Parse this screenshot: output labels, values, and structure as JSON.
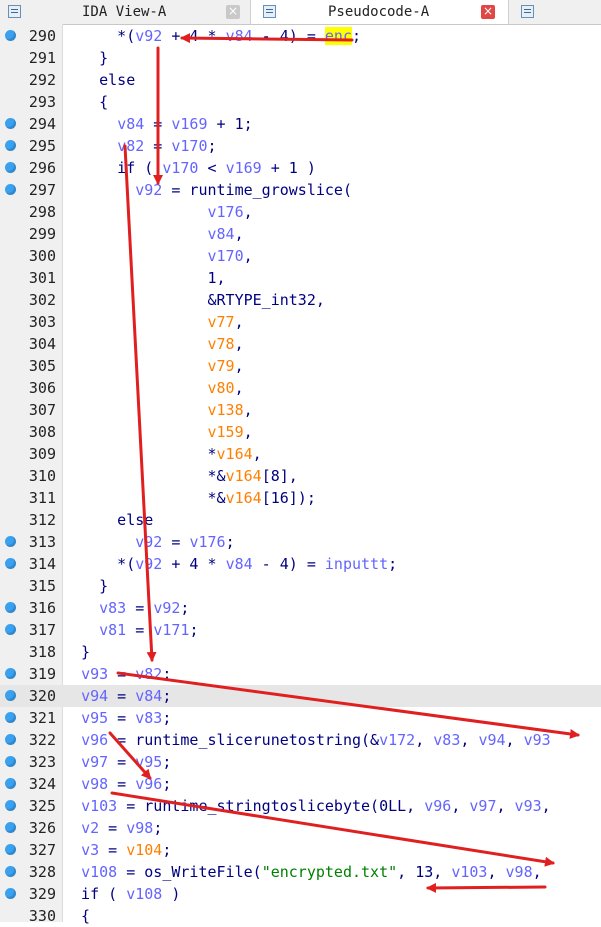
{
  "tabs": [
    {
      "label": "IDA View-A",
      "active": false,
      "close": "grey"
    },
    {
      "label": "Pseudocode-A",
      "active": true,
      "close": "red"
    },
    {
      "label": "",
      "active": false,
      "close": ""
    }
  ],
  "colors": {
    "variable": "#6464ff",
    "symbol": "#ff8000",
    "string": "#008000",
    "keyword": "#000080",
    "breakpoint": "#3aa0f0",
    "highlight": "#ffff00",
    "annotation_arrow": "#e02020"
  },
  "selected_line": 320,
  "code": {
    "lines": [
      {
        "num": "290",
        "bp": true,
        "tokens": [
          [
            "      *(",
            ""
          ],
          [
            "v92",
            "v"
          ],
          [
            " + 4 * ",
            ""
          ],
          [
            "v84",
            "v"
          ],
          [
            " - 4) = ",
            ""
          ],
          [
            "enc",
            "e"
          ],
          [
            ";",
            ""
          ]
        ]
      },
      {
        "num": "291",
        "bp": false,
        "tokens": [
          [
            "    }",
            ""
          ]
        ]
      },
      {
        "num": "292",
        "bp": false,
        "tokens": [
          [
            "    else",
            ""
          ]
        ]
      },
      {
        "num": "293",
        "bp": false,
        "tokens": [
          [
            "    {",
            ""
          ]
        ]
      },
      {
        "num": "294",
        "bp": true,
        "tokens": [
          [
            "      ",
            ""
          ],
          [
            "v84",
            "v"
          ],
          [
            " = ",
            ""
          ],
          [
            "v169",
            "v"
          ],
          [
            " + 1;",
            ""
          ]
        ]
      },
      {
        "num": "295",
        "bp": true,
        "tokens": [
          [
            "      ",
            ""
          ],
          [
            "v82",
            "v"
          ],
          [
            " = ",
            ""
          ],
          [
            "v170",
            "v"
          ],
          [
            ";",
            ""
          ]
        ]
      },
      {
        "num": "296",
        "bp": true,
        "tokens": [
          [
            "      if ( ",
            ""
          ],
          [
            "v170",
            "v"
          ],
          [
            " < ",
            ""
          ],
          [
            "v169",
            "v"
          ],
          [
            " + 1 )",
            ""
          ]
        ]
      },
      {
        "num": "297",
        "bp": true,
        "tokens": [
          [
            "        ",
            ""
          ],
          [
            "v92",
            "v"
          ],
          [
            " = runtime_growslice(",
            ""
          ]
        ]
      },
      {
        "num": "298",
        "bp": false,
        "tokens": [
          [
            "                ",
            ""
          ],
          [
            "v176",
            "v"
          ],
          [
            ",",
            ""
          ]
        ]
      },
      {
        "num": "299",
        "bp": false,
        "tokens": [
          [
            "                ",
            ""
          ],
          [
            "v84",
            "v"
          ],
          [
            ",",
            ""
          ]
        ]
      },
      {
        "num": "300",
        "bp": false,
        "tokens": [
          [
            "                ",
            ""
          ],
          [
            "v170",
            "v"
          ],
          [
            ",",
            ""
          ]
        ]
      },
      {
        "num": "301",
        "bp": false,
        "tokens": [
          [
            "                1,",
            ""
          ]
        ]
      },
      {
        "num": "302",
        "bp": false,
        "tokens": [
          [
            "                &RTYPE_int32,",
            ""
          ]
        ]
      },
      {
        "num": "303",
        "bp": false,
        "tokens": [
          [
            "                ",
            ""
          ],
          [
            "v77",
            "s"
          ],
          [
            ",",
            ""
          ]
        ]
      },
      {
        "num": "304",
        "bp": false,
        "tokens": [
          [
            "                ",
            ""
          ],
          [
            "v78",
            "s"
          ],
          [
            ",",
            ""
          ]
        ]
      },
      {
        "num": "305",
        "bp": false,
        "tokens": [
          [
            "                ",
            ""
          ],
          [
            "v79",
            "s"
          ],
          [
            ",",
            ""
          ]
        ]
      },
      {
        "num": "306",
        "bp": false,
        "tokens": [
          [
            "                ",
            ""
          ],
          [
            "v80",
            "s"
          ],
          [
            ",",
            ""
          ]
        ]
      },
      {
        "num": "307",
        "bp": false,
        "tokens": [
          [
            "                ",
            ""
          ],
          [
            "v138",
            "s"
          ],
          [
            ",",
            ""
          ]
        ]
      },
      {
        "num": "308",
        "bp": false,
        "tokens": [
          [
            "                ",
            ""
          ],
          [
            "v159",
            "s"
          ],
          [
            ",",
            ""
          ]
        ]
      },
      {
        "num": "309",
        "bp": false,
        "tokens": [
          [
            "                *",
            ""
          ],
          [
            "v164",
            "s"
          ],
          [
            ",",
            ""
          ]
        ]
      },
      {
        "num": "310",
        "bp": false,
        "tokens": [
          [
            "                *&",
            ""
          ],
          [
            "v164",
            "s"
          ],
          [
            "[8],",
            ""
          ]
        ]
      },
      {
        "num": "311",
        "bp": false,
        "tokens": [
          [
            "                *&",
            ""
          ],
          [
            "v164",
            "s"
          ],
          [
            "[16]);",
            ""
          ]
        ]
      },
      {
        "num": "312",
        "bp": false,
        "tokens": [
          [
            "      else",
            ""
          ]
        ]
      },
      {
        "num": "313",
        "bp": true,
        "tokens": [
          [
            "        ",
            ""
          ],
          [
            "v92",
            "v"
          ],
          [
            " = ",
            ""
          ],
          [
            "v176",
            "v"
          ],
          [
            ";",
            ""
          ]
        ]
      },
      {
        "num": "314",
        "bp": true,
        "tokens": [
          [
            "      *(",
            ""
          ],
          [
            "v92",
            "v"
          ],
          [
            " + 4 * ",
            ""
          ],
          [
            "v84",
            "v"
          ],
          [
            " - 4) = ",
            ""
          ],
          [
            "inputtt",
            "v"
          ],
          [
            ";",
            ""
          ]
        ]
      },
      {
        "num": "315",
        "bp": false,
        "tokens": [
          [
            "    }",
            ""
          ]
        ]
      },
      {
        "num": "316",
        "bp": true,
        "tokens": [
          [
            "    ",
            ""
          ],
          [
            "v83",
            "v"
          ],
          [
            " = ",
            ""
          ],
          [
            "v92",
            "v"
          ],
          [
            ";",
            ""
          ]
        ]
      },
      {
        "num": "317",
        "bp": true,
        "tokens": [
          [
            "    ",
            ""
          ],
          [
            "v81",
            "v"
          ],
          [
            " = ",
            ""
          ],
          [
            "v171",
            "v"
          ],
          [
            ";",
            ""
          ]
        ]
      },
      {
        "num": "318",
        "bp": false,
        "tokens": [
          [
            "  }",
            ""
          ]
        ]
      },
      {
        "num": "319",
        "bp": true,
        "tokens": [
          [
            "  ",
            ""
          ],
          [
            "v93",
            "v"
          ],
          [
            " = ",
            ""
          ],
          [
            "v82",
            "v"
          ],
          [
            ";",
            ""
          ]
        ]
      },
      {
        "num": "320",
        "bp": true,
        "tokens": [
          [
            "  ",
            ""
          ],
          [
            "v94",
            "v"
          ],
          [
            " = ",
            ""
          ],
          [
            "v84",
            "v"
          ],
          [
            ";",
            ""
          ]
        ]
      },
      {
        "num": "321",
        "bp": true,
        "tokens": [
          [
            "  ",
            ""
          ],
          [
            "v95",
            "v"
          ],
          [
            " = ",
            ""
          ],
          [
            "v83",
            "v"
          ],
          [
            ";",
            ""
          ]
        ]
      },
      {
        "num": "322",
        "bp": true,
        "tokens": [
          [
            "  ",
            ""
          ],
          [
            "v96",
            "v"
          ],
          [
            " = runtime_slicerunetostring(&",
            ""
          ],
          [
            "v172",
            "v"
          ],
          [
            ", ",
            ""
          ],
          [
            "v83",
            "v"
          ],
          [
            ", ",
            ""
          ],
          [
            "v94",
            "v"
          ],
          [
            ", ",
            ""
          ],
          [
            "v93",
            "v"
          ]
        ]
      },
      {
        "num": "323",
        "bp": true,
        "tokens": [
          [
            "  ",
            ""
          ],
          [
            "v97",
            "v"
          ],
          [
            " = ",
            ""
          ],
          [
            "v95",
            "v"
          ],
          [
            ";",
            ""
          ]
        ]
      },
      {
        "num": "324",
        "bp": true,
        "tokens": [
          [
            "  ",
            ""
          ],
          [
            "v98",
            "v"
          ],
          [
            " = ",
            ""
          ],
          [
            "v96",
            "v"
          ],
          [
            ";",
            ""
          ]
        ]
      },
      {
        "num": "325",
        "bp": true,
        "tokens": [
          [
            "  ",
            ""
          ],
          [
            "v103",
            "v"
          ],
          [
            " = runtime_stringtoslicebyte(0LL, ",
            ""
          ],
          [
            "v96",
            "v"
          ],
          [
            ", ",
            ""
          ],
          [
            "v97",
            "v"
          ],
          [
            ", ",
            ""
          ],
          [
            "v93",
            "v"
          ],
          [
            ",",
            ""
          ]
        ]
      },
      {
        "num": "326",
        "bp": true,
        "tokens": [
          [
            "  ",
            ""
          ],
          [
            "v2",
            "v"
          ],
          [
            " = ",
            ""
          ],
          [
            "v98",
            "v"
          ],
          [
            ";",
            ""
          ]
        ]
      },
      {
        "num": "327",
        "bp": true,
        "tokens": [
          [
            "  ",
            ""
          ],
          [
            "v3",
            "v"
          ],
          [
            " = ",
            ""
          ],
          [
            "v104",
            "s"
          ],
          [
            ";",
            ""
          ]
        ]
      },
      {
        "num": "328",
        "bp": true,
        "tokens": [
          [
            "  ",
            ""
          ],
          [
            "v108",
            "v"
          ],
          [
            " = os_WriteFile(",
            ""
          ],
          [
            "\"encrypted.txt\"",
            "t"
          ],
          [
            ", 13, ",
            ""
          ],
          [
            "v103",
            "v"
          ],
          [
            ", ",
            ""
          ],
          [
            "v98",
            "v"
          ],
          [
            ",",
            ""
          ]
        ]
      },
      {
        "num": "329",
        "bp": true,
        "tokens": [
          [
            "  if ( ",
            ""
          ],
          [
            "v108",
            "v"
          ],
          [
            " )",
            ""
          ]
        ]
      },
      {
        "num": "330",
        "bp": false,
        "tokens": [
          [
            "  {",
            ""
          ]
        ]
      }
    ]
  }
}
